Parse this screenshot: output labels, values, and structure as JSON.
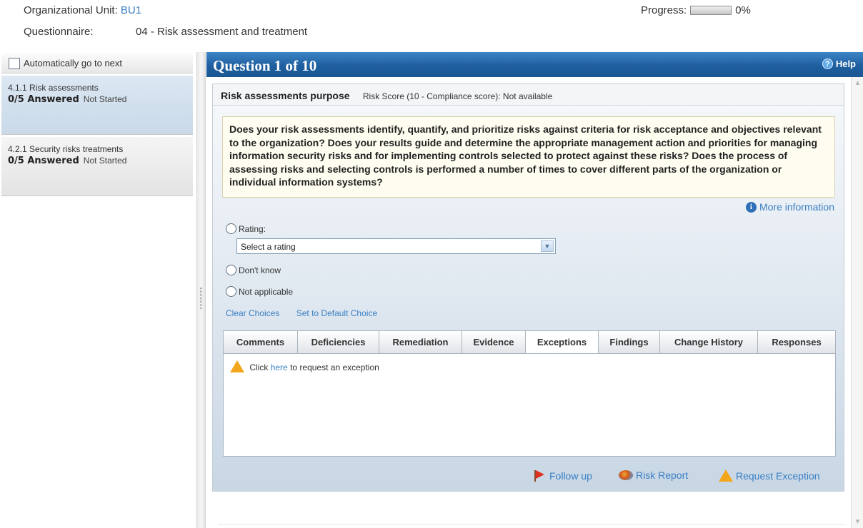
{
  "header": {
    "org_unit_label": "Organizational Unit:",
    "org_unit_value": "BU1",
    "questionnaire_label": "Questionnaire:",
    "questionnaire_value": "04 - Risk assessment and treatment",
    "progress_label": "Progress:",
    "progress_value": "0%",
    "progress_fraction": 0
  },
  "sidebar": {
    "auto_next_label": "Automatically go to next",
    "auto_next_checked": false,
    "sections": [
      {
        "title": "4.1.1 Risk assessments",
        "answered": "0/5 Answered",
        "status": "Not Started",
        "selected": true
      },
      {
        "title": "4.2.1 Security risks treatments",
        "answered": "0/5 Answered",
        "status": "Not Started",
        "selected": false
      }
    ]
  },
  "question": {
    "header_title": "Question 1 of 10",
    "help_label": "Help",
    "name": "Risk assessments purpose",
    "risk_score": "Risk Score (10 - Compliance score): Not available",
    "text": "Does your risk assessments identify, quantify, and prioritize risks against criteria for risk acceptance and objectives relevant to the organization? Does your results guide and determine the appropriate management action and priorities for managing information security risks and for implementing controls selected to protect against these risks? Does the process of assessing risks and selecting controls is performed a number of times to cover different parts of the organization or individual information systems?",
    "more_info_label": "More information"
  },
  "answer": {
    "rating_label": "Rating:",
    "rating_selected": "Select a rating",
    "dont_know_label": "Don't know",
    "not_applicable_label": "Not applicable",
    "clear_choices_label": "Clear Choices",
    "default_choice_label": "Set to Default Choice"
  },
  "tabs": [
    {
      "label": "Comments",
      "active": false
    },
    {
      "label": "Deficiencies",
      "active": false
    },
    {
      "label": "Remediation",
      "active": false
    },
    {
      "label": "Evidence",
      "active": false
    },
    {
      "label": "Exceptions",
      "active": true
    },
    {
      "label": "Findings",
      "active": false
    },
    {
      "label": "Change History",
      "active": false
    },
    {
      "label": "Responses",
      "active": false
    }
  ],
  "exceptions_tab": {
    "prefix": "Click",
    "link": "here",
    "suffix": "to request an exception"
  },
  "actions": {
    "follow_up": "Follow up",
    "risk_report": "Risk Report",
    "request_exception": "Request Exception"
  },
  "icons": {
    "help": "help-icon",
    "info": "info-icon",
    "warning": "warning-icon",
    "flag": "flag-icon",
    "report": "risk-report-icon"
  },
  "colors": {
    "accent_blue": "#1f5f9f",
    "link_blue": "#3a7fc4",
    "warning_orange": "#f3a51b"
  }
}
